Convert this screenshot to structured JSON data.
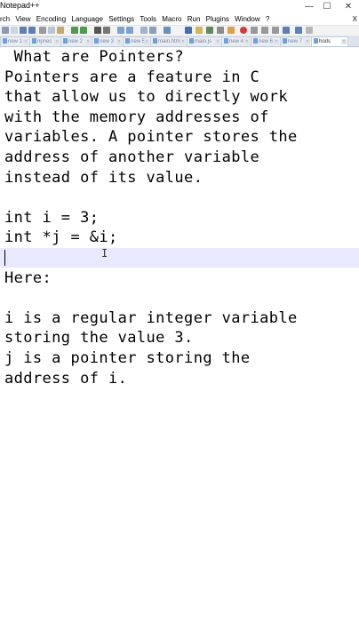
{
  "window": {
    "title": "Notepad++",
    "min_glyph": "—",
    "max_glyph": "☐",
    "close_glyph": "✕"
  },
  "menu": {
    "items": [
      "rch",
      "View",
      "Encoding",
      "Language",
      "Settings",
      "Tools",
      "Macro",
      "Run",
      "Plugins",
      "Window",
      "?"
    ],
    "close_x": "X"
  },
  "tabs": [
    {
      "label": "new 1"
    },
    {
      "label": "npnec"
    },
    {
      "label": "new 2"
    },
    {
      "label": "new 3"
    },
    {
      "label": "new 5"
    },
    {
      "label": "main.html"
    },
    {
      "label": "main.js"
    },
    {
      "label": "new 4"
    },
    {
      "label": "new 6"
    },
    {
      "label": "new 7"
    },
    {
      "label": "hods"
    }
  ],
  "editor": {
    "lines": [
      " What are Pointers?",
      "Pointers are a feature in C",
      "that allow us to directly work",
      "with the memory addresses of",
      "variables. A pointer stores the",
      "address of another variable",
      "instead of its value.",
      "",
      "int i = 3;",
      "int *j = &i;",
      "",
      "Here:",
      "",
      "i is a regular integer variable",
      "storing the value 3.",
      "j is a pointer storing the",
      "address of i."
    ],
    "current_line_index": 10,
    "ibeam_glyph": "I"
  }
}
